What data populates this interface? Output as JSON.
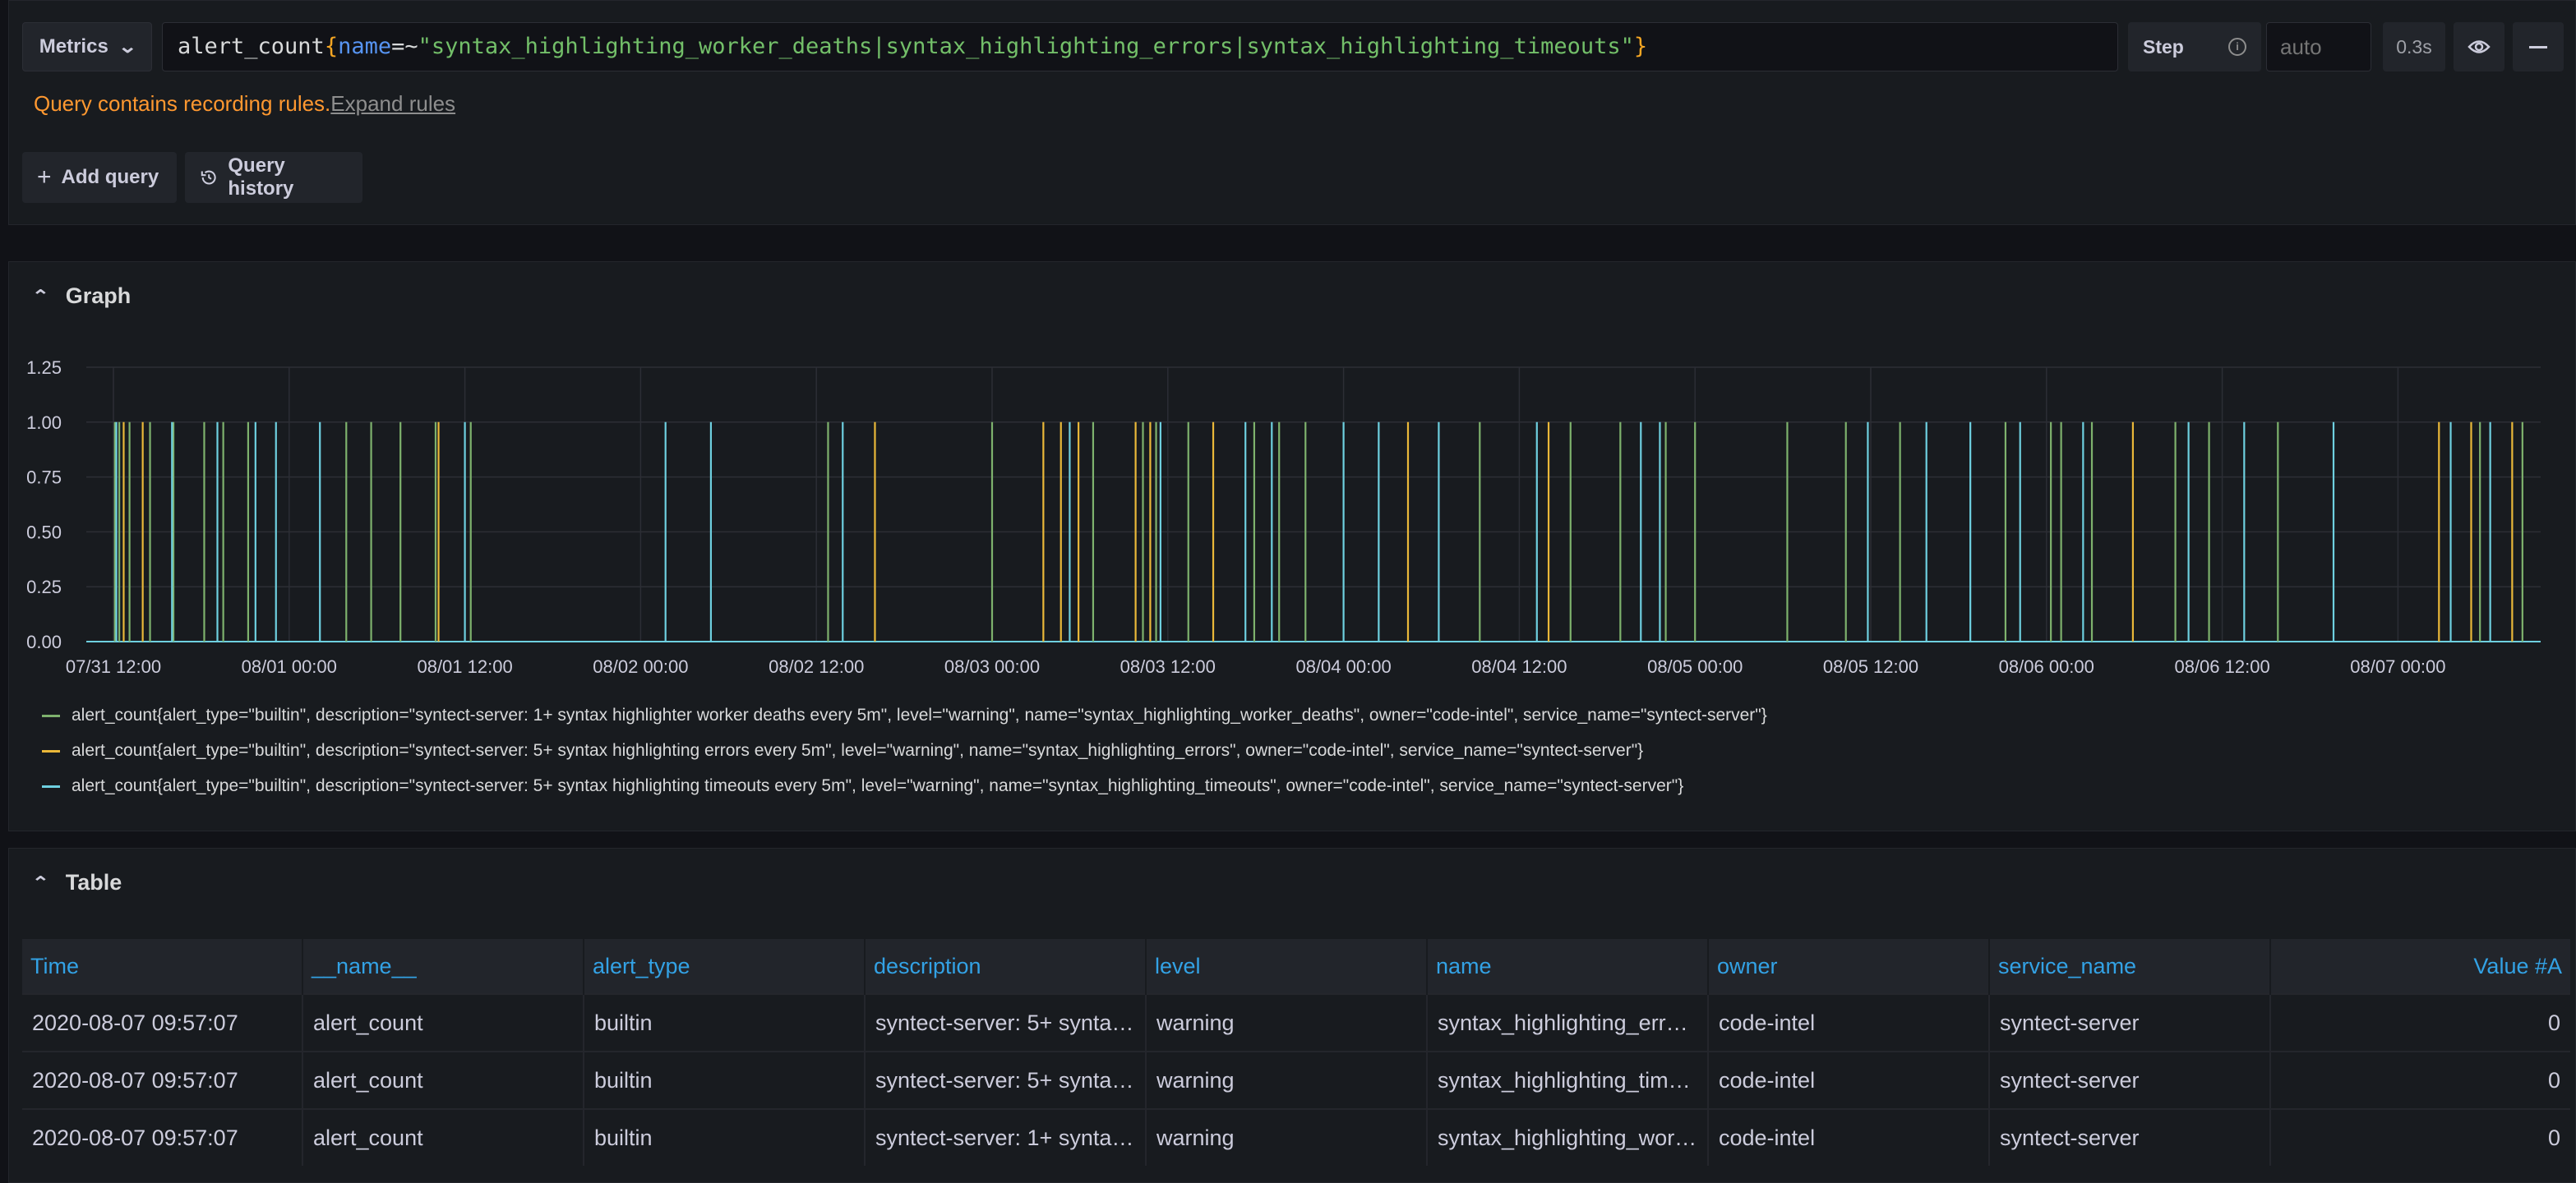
{
  "query_editor": {
    "datasource_label": "Metrics",
    "query": {
      "metric": "alert_count",
      "open_brace": "{",
      "label": "name",
      "operator": "=~",
      "value": "\"syntax_highlighting_worker_deaths|syntax_highlighting_errors|syntax_highlighting_timeouts\"",
      "close_brace": "}"
    },
    "step_label": "Step",
    "step_placeholder": "auto",
    "query_time": "0.3s",
    "rules_warning": "Query contains recording rules.",
    "expand_rules": "Expand rules",
    "add_query_label": "Add query",
    "query_history_label": "Query history"
  },
  "graph": {
    "title": "Graph",
    "legend": [
      {
        "label": "alert_count{alert_type=\"builtin\", description=\"syntect-server: 1+ syntax highlighter worker deaths every 5m\", level=\"warning\", name=\"syntax_highlighting_worker_deaths\", owner=\"code-intel\", service_name=\"syntect-server\"}",
        "color": "#7eb26d"
      },
      {
        "label": "alert_count{alert_type=\"builtin\", description=\"syntect-server: 5+ syntax highlighting errors every 5m\", level=\"warning\", name=\"syntax_highlighting_errors\", owner=\"code-intel\", service_name=\"syntect-server\"}",
        "color": "#eab839"
      },
      {
        "label": "alert_count{alert_type=\"builtin\", description=\"syntect-server: 5+ syntax highlighting timeouts every 5m\", level=\"warning\", name=\"syntax_highlighting_timeouts\", owner=\"code-intel\", service_name=\"syntect-server\"}",
        "color": "#6ed0e0"
      }
    ]
  },
  "chart_data": {
    "type": "line",
    "x_range": [
      "2020-07-31 12:00",
      "2020-08-07 06:00"
    ],
    "x_ticks": [
      "07/31 12:00",
      "08/01 00:00",
      "08/01 12:00",
      "08/02 00:00",
      "08/02 12:00",
      "08/03 00:00",
      "08/03 12:00",
      "08/04 00:00",
      "08/04 12:00",
      "08/05 00:00",
      "08/05 12:00",
      "08/06 00:00",
      "08/06 12:00",
      "08/07 00:00"
    ],
    "y_ticks": [
      "0.00",
      "0.25",
      "0.50",
      "0.75",
      "1.00",
      "1.25"
    ],
    "ylim": [
      0,
      1.25
    ],
    "series": [
      {
        "name": "syntax_highlighting_worker_deaths",
        "color": "#7eb26d",
        "spike_times_h": [
          0.1,
          0.4,
          1.1,
          2.5,
          4.1,
          6.2,
          7.5,
          9.2,
          15.9,
          17.6,
          19.6,
          22.0,
          24.4,
          48.8,
          60.0,
          66.9,
          70.3,
          71.2,
          73.4,
          77.9,
          79.6,
          81.4,
          93.3,
          99.5,
          102.9,
          106.0,
          108.0,
          114.3,
          118.3,
          122.0,
          129.2,
          132.3,
          133.0,
          135.1,
          140.8,
          143.1,
          147.8,
          161.6,
          164.5,
          166.9
        ]
      },
      {
        "name": "syntax_highlighting_errors",
        "color": "#eab839",
        "spike_times_h": [
          0.7,
          2.0,
          22.2,
          52.0,
          63.5,
          64.7,
          65.9,
          69.8,
          70.8,
          75.1,
          88.4,
          98.0,
          137.9,
          158.8,
          161.0,
          163.8,
          171.6
        ]
      },
      {
        "name": "syntax_highlighting_timeouts",
        "color": "#6ed0e0",
        "spike_times_h": [
          0.2,
          4.0,
          7.1,
          9.7,
          11.1,
          14.1,
          24.0,
          37.7,
          40.8,
          49.8,
          65.3,
          71.5,
          77.3,
          79.1,
          84.0,
          86.4,
          90.5,
          97.2,
          104.3,
          105.6,
          119.8,
          123.8,
          126.8,
          130.2,
          134.5,
          141.7,
          145.5,
          151.6,
          159.6,
          162.3,
          165.8,
          171.3
        ]
      }
    ]
  },
  "table": {
    "title": "Table",
    "columns": [
      "Time",
      "__name__",
      "alert_type",
      "description",
      "level",
      "name",
      "owner",
      "service_name",
      "Value #A"
    ],
    "rows": [
      [
        "2020-08-07 09:57:07",
        "alert_count",
        "builtin",
        "syntect-server: 5+ synta…",
        "warning",
        "syntax_highlighting_err…",
        "code-intel",
        "syntect-server",
        "0"
      ],
      [
        "2020-08-07 09:57:07",
        "alert_count",
        "builtin",
        "syntect-server: 5+ synta…",
        "warning",
        "syntax_highlighting_tim…",
        "code-intel",
        "syntect-server",
        "0"
      ],
      [
        "2020-08-07 09:57:07",
        "alert_count",
        "builtin",
        "syntect-server: 1+ synta…",
        "warning",
        "syntax_highlighting_wor…",
        "code-intel",
        "syntect-server",
        "0"
      ]
    ]
  }
}
